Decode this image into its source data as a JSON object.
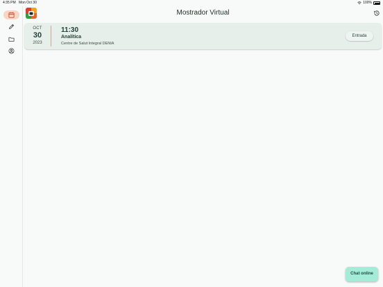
{
  "status_bar": {
    "time": "4:35 PM",
    "date": "Mon Oct 30",
    "battery": "100%"
  },
  "sidebar": {
    "items": [
      {
        "name": "calendar",
        "icon": "calendar-icon",
        "active": true
      },
      {
        "name": "edit",
        "icon": "pencil-icon",
        "active": false
      },
      {
        "name": "folder",
        "icon": "folder-icon",
        "active": false
      },
      {
        "name": "profile",
        "icon": "user-circle-icon",
        "active": false
      }
    ]
  },
  "header": {
    "title": "Mostrador Virtual",
    "history_icon": "history-icon"
  },
  "appointments": [
    {
      "month": "OCT",
      "day": "30",
      "year": "2023",
      "time": "11:30",
      "type": "Analítica",
      "place": "Centre de Salut Integral DENIA",
      "action_label": "Entrada"
    }
  ],
  "chat": {
    "label": "Chat online"
  },
  "colors": {
    "accent_active": "#f8d6c4",
    "card_bg": "#e7efeb",
    "chat_bg": "#a4ecd8",
    "text_primary": "#23403a"
  }
}
